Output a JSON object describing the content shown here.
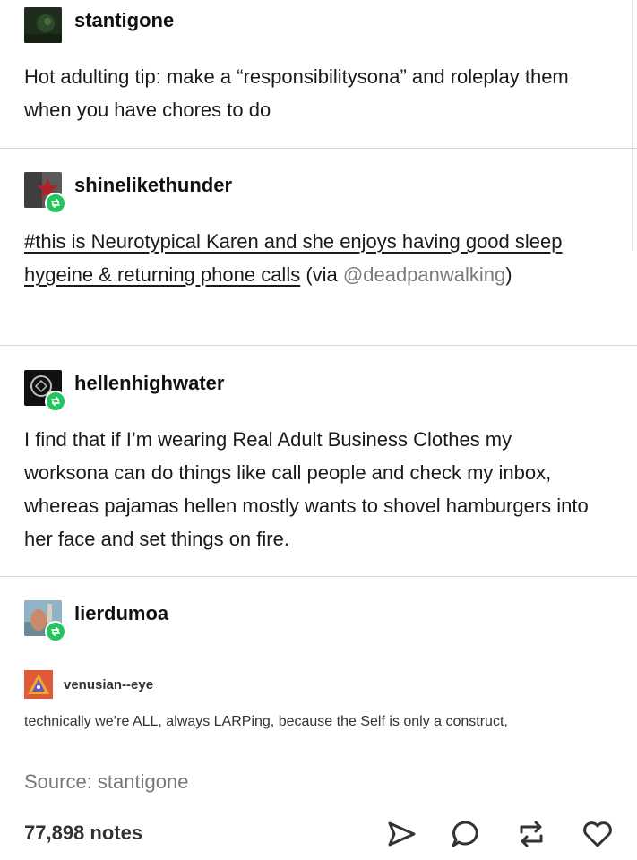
{
  "posts": [
    {
      "username": "stantigone",
      "body": "Hot adulting tip: make a “responsibilitysona” and roleplay them when you have chores to do"
    },
    {
      "username": "shinelikethunder",
      "body_hashtag": "#this is Neurotypical Karen and she enjoys having good sleep hygeine & returning phone calls",
      "via_prefix": " (via ",
      "via_user": "@deadpanwalking",
      "via_suffix": ")"
    },
    {
      "username": "hellenhighwater",
      "body": "I find that if I’m wearing Real Adult Business Clothes my worksona can do things like call people and check my inbox, whereas pajamas hellen mostly wants to shovel hamburgers into her face and set things on fire."
    },
    {
      "username": "lierdumoa"
    }
  ],
  "embedded": {
    "username": "venusian--eye",
    "text": "technically we’re ALL, always LARPing, because the Self is only a construct,"
  },
  "source": "Source: stantigone",
  "notes": "77,898 notes",
  "colors": {
    "reblog_badge": "#22c55e",
    "divider": "#d6d6d6",
    "mention": "#7a7a7a"
  },
  "icons": [
    "share-icon",
    "reply-icon",
    "reblog-icon",
    "like-icon"
  ]
}
